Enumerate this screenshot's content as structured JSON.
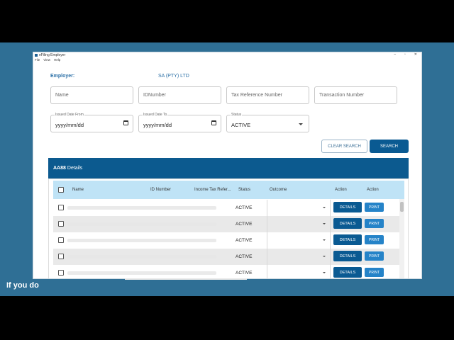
{
  "window": {
    "title": "eFiling Employer",
    "controls": [
      "–",
      "▫",
      "✕"
    ]
  },
  "menu": [
    "File",
    "View",
    "Help"
  ],
  "employer": {
    "label": "Employer:",
    "value": "SA (PTY) LTD"
  },
  "filters": {
    "name_placeholder": "Name",
    "id_placeholder": "IDNumber",
    "tax_ref_placeholder": "Tax Reference Number",
    "transaction_placeholder": "Transaction Number",
    "issued_from_label": "Issued Date From",
    "issued_from_value": "yyyy/mm/dd",
    "issued_to_label": "Issued Date To",
    "issued_to_value": "yyyy/mm/dd",
    "status_label": "Status",
    "status_value": "ACTIVE"
  },
  "buttons": {
    "clear": "CLEAR SEARCH",
    "search": "SEARCH"
  },
  "section": {
    "title_bold": "AA88",
    "title_rest": "Details"
  },
  "table": {
    "columns": [
      "Name",
      "ID Number",
      "Income Tax Refer...",
      "Status",
      "Outcome",
      "Action",
      "Action"
    ],
    "rows": [
      {
        "status": "ACTIVE",
        "details": "DETAILS",
        "print": "PRINT"
      },
      {
        "status": "ACTIVE",
        "details": "DETAILS",
        "print": "PRINT"
      },
      {
        "status": "ACTIVE",
        "details": "DETAILS",
        "print": "PRINT"
      },
      {
        "status": "ACTIVE",
        "details": "DETAILS",
        "print": "PRINT"
      },
      {
        "status": "ACTIVE",
        "details": "DETAILS",
        "print": "PRINT"
      }
    ]
  },
  "caption": "If you do",
  "colors": {
    "background": "#2f6f95",
    "primary": "#0a5a92",
    "print_button": "#2583c8",
    "header_row": "#bfe3f6"
  }
}
